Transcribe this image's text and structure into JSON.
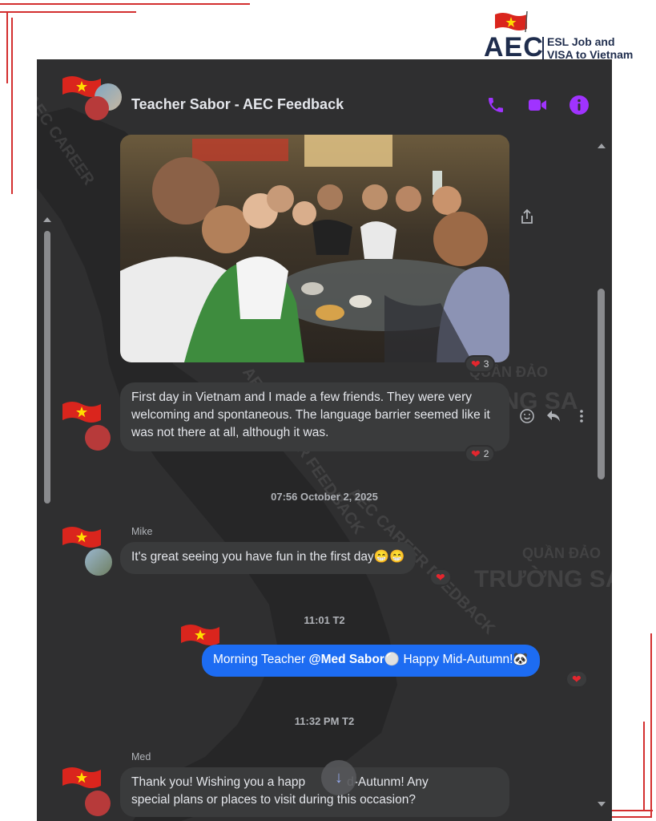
{
  "brand": {
    "logo_text": "AEC",
    "line1": "ESL Job and",
    "line2": "VISA to Vietnam"
  },
  "header": {
    "title": "Teacher Sabor - AEC Feedback",
    "icons": [
      "phone-icon",
      "video-icon",
      "info-icon"
    ],
    "accent_color": "#a033ff"
  },
  "messages": [
    {
      "type": "photo",
      "reaction_count": "3"
    },
    {
      "type": "text",
      "text": "First day in Vietnam and I made a few friends. They were very welcoming and spontaneous. The language barrier seemed like it was not there at all, although it was.",
      "reaction_count": "2"
    },
    {
      "type": "timestamp",
      "text": "07:56 October 2, 2025"
    },
    {
      "type": "text",
      "sender": "Mike",
      "text": "It's great seeing you have fun in the first day😁😁"
    },
    {
      "type": "timestamp",
      "text": "11:01 T2"
    },
    {
      "type": "text",
      "mine": true,
      "text_before": "Morning Teacher ",
      "mention": "@Med Sabor",
      "text_after": "⚪ Happy Mid-Autumn!🐼"
    },
    {
      "type": "timestamp",
      "text": "11:32 PM T2"
    },
    {
      "type": "text",
      "sender": "Med",
      "line1": "Thank you! Wishing you a happ",
      "line1_end": "d-Autunm! Any",
      "line2": "special plans or places to visit during this occasion?"
    }
  ],
  "watermarks": {
    "diagonal": "AEC CAREER FEEDBACK",
    "diagonal_top": "AEC CAREER",
    "island1_line1": "QUẦN ĐẢO",
    "island1_line2": "TRƯỜNG SA",
    "island2_line1": "QUẦN ĐẢO",
    "island2_line2": "TRƯỜNG SA"
  },
  "colors": {
    "chat_bg": "#2f2f30",
    "bubble": "#3a3b3c",
    "mine_bubble": "#1d6cf2",
    "frame_red": "#d32f2f"
  }
}
